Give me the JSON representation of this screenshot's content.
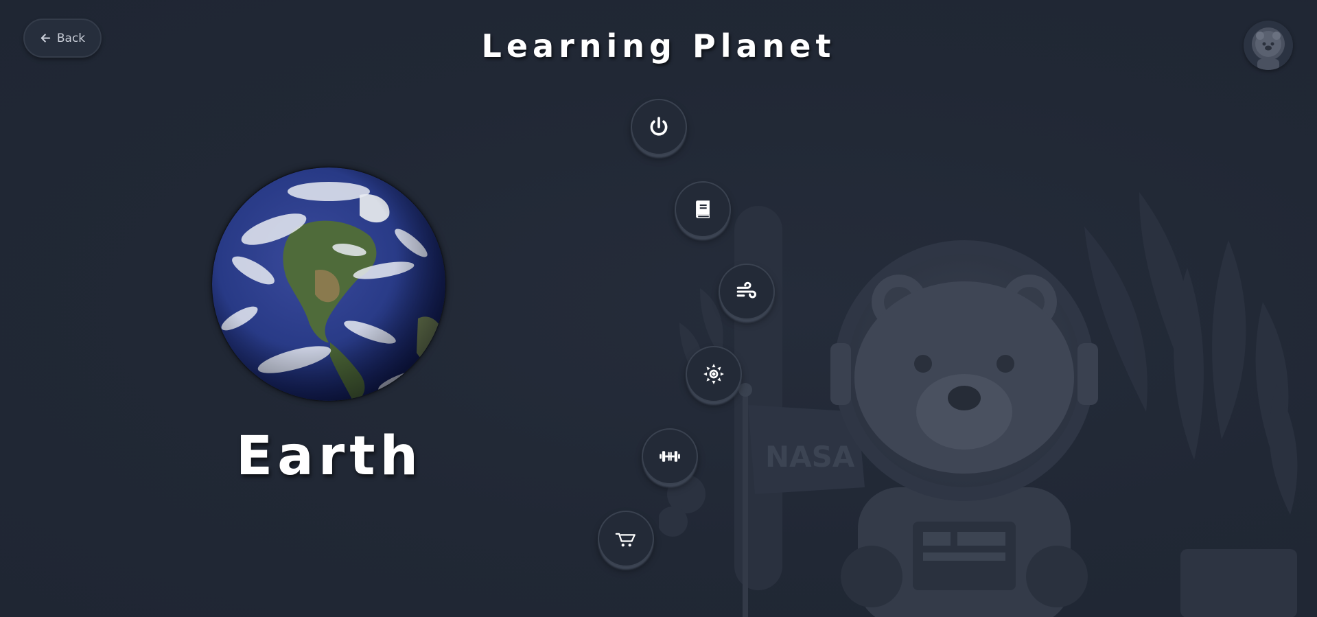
{
  "header": {
    "back_label": "Back",
    "title": "Learning Planet"
  },
  "planet": {
    "name": "Earth"
  },
  "menu": [
    {
      "id": "power",
      "icon": "power-icon"
    },
    {
      "id": "book",
      "icon": "book-icon"
    },
    {
      "id": "wind",
      "icon": "wind-icon"
    },
    {
      "id": "sun",
      "icon": "sun-icon"
    },
    {
      "id": "dumbbell",
      "icon": "dumbbell-icon"
    },
    {
      "id": "cart",
      "icon": "cart-icon"
    }
  ],
  "colors": {
    "background": "#212835",
    "button_bg": "#232a37",
    "button_border": "#3a4250",
    "text": "#ffffff",
    "back_text": "#c9ced8"
  },
  "background_illustration": {
    "flag_text": "NASA"
  }
}
